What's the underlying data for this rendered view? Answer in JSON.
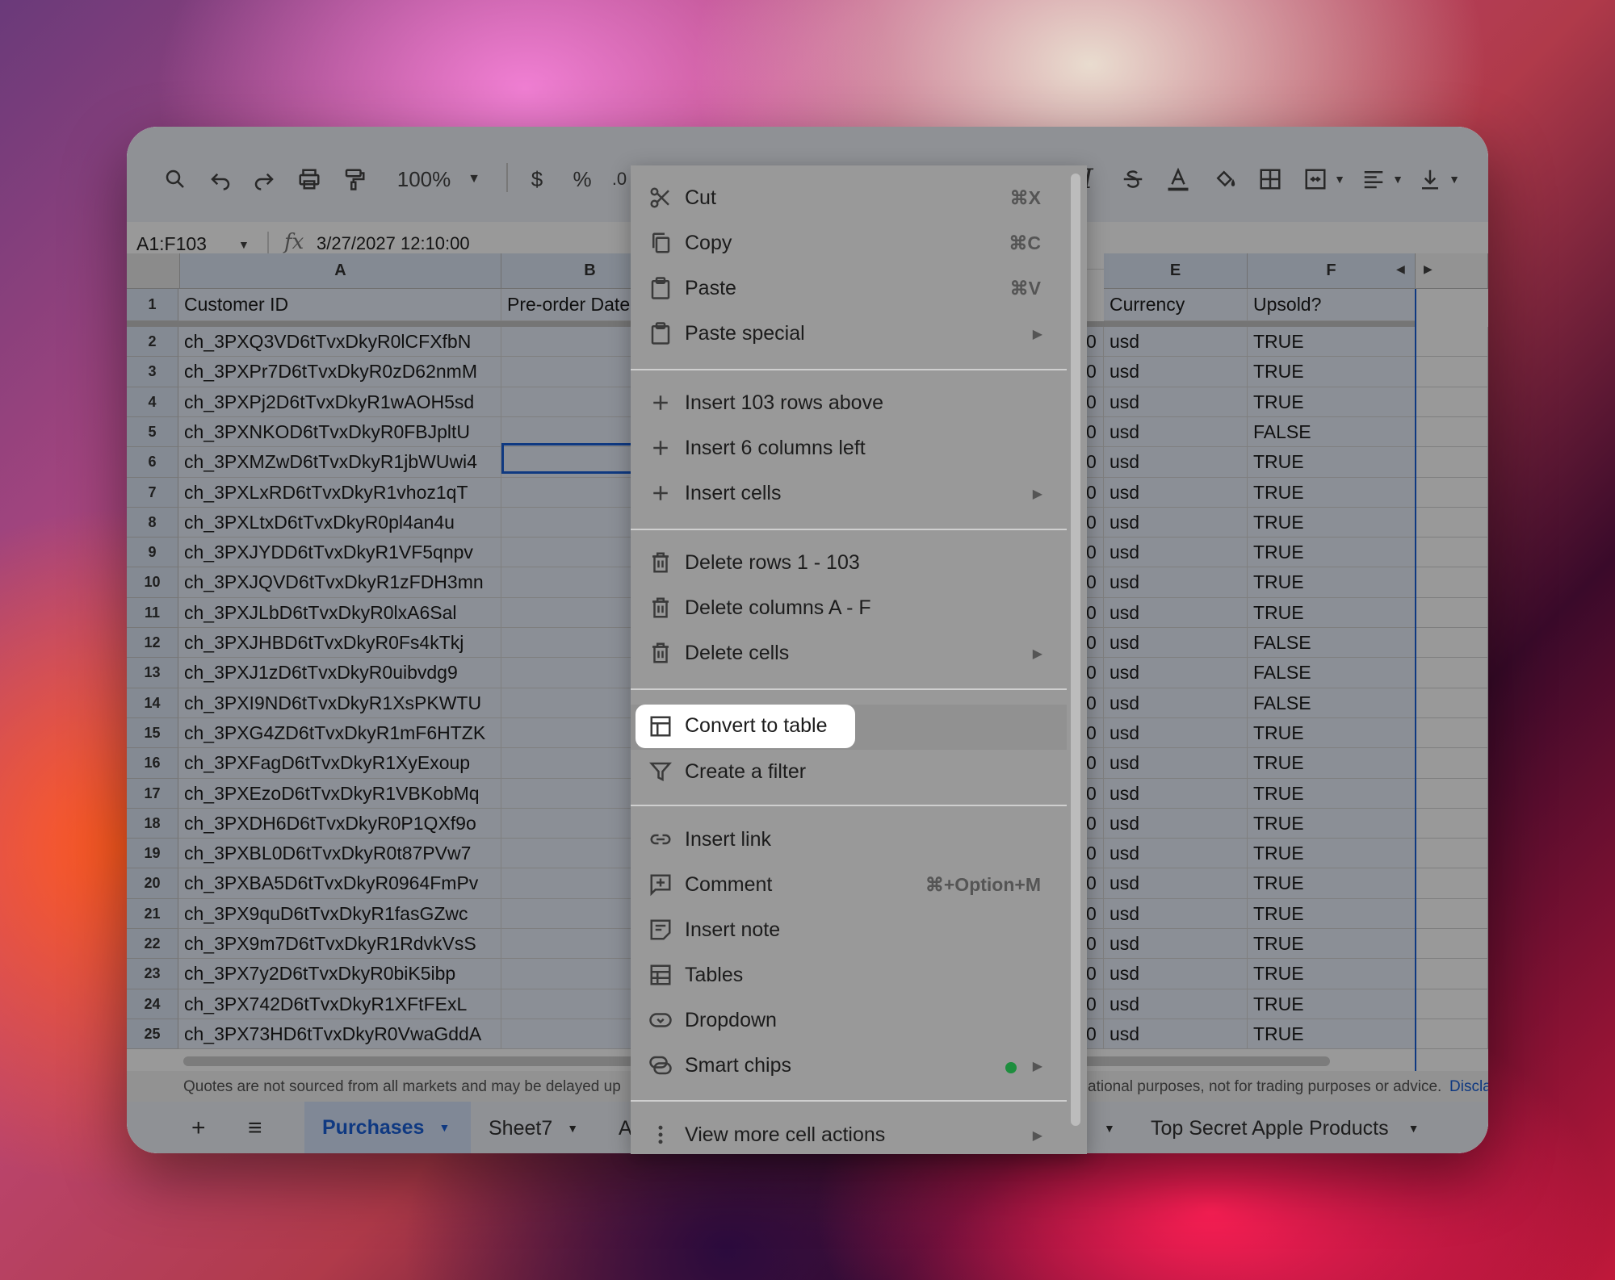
{
  "toolbar": {
    "zoom": "100%",
    "currency_symbol": "$",
    "percent_symbol": "%",
    "decimal_label": ".0"
  },
  "formula_bar": {
    "name_box": "A1:F103",
    "fx_label": "fx",
    "value": "3/27/2027 12:10:00"
  },
  "columns": [
    "A",
    "B",
    "E",
    "F"
  ],
  "header_row": {
    "row_number": "1",
    "customer_id": "Customer ID",
    "preorder": "Pre-order Date",
    "currency": "Currency",
    "upsold": "Upsold?"
  },
  "rows": [
    {
      "n": "2",
      "id": "ch_3PXQ3VD6tTvxDkyR0lCFXfbN",
      "d": "0",
      "cur": "usd",
      "up": "TRUE"
    },
    {
      "n": "3",
      "id": "ch_3PXPr7D6tTvxDkyR0zD62nmM",
      "d": "0",
      "cur": "usd",
      "up": "TRUE"
    },
    {
      "n": "4",
      "id": "ch_3PXPj2D6tTvxDkyR1wAOH5sd",
      "d": "0",
      "cur": "usd",
      "up": "TRUE"
    },
    {
      "n": "5",
      "id": "ch_3PXNKOD6tTvxDkyR0FBJpltU",
      "d": "0",
      "cur": "usd",
      "up": "FALSE"
    },
    {
      "n": "6",
      "id": "ch_3PXMZwD6tTvxDkyR1jbWUwi4",
      "d": "0",
      "cur": "usd",
      "up": "TRUE"
    },
    {
      "n": "7",
      "id": "ch_3PXLxRD6tTvxDkyR1vhoz1qT",
      "d": "0",
      "cur": "usd",
      "up": "TRUE"
    },
    {
      "n": "8",
      "id": "ch_3PXLtxD6tTvxDkyR0pl4an4u",
      "d": "0",
      "cur": "usd",
      "up": "TRUE"
    },
    {
      "n": "9",
      "id": "ch_3PXJYDD6tTvxDkyR1VF5qnpv",
      "d": "0",
      "cur": "usd",
      "up": "TRUE"
    },
    {
      "n": "10",
      "id": "ch_3PXJQVD6tTvxDkyR1zFDH3mn",
      "d": "0",
      "cur": "usd",
      "up": "TRUE"
    },
    {
      "n": "11",
      "id": "ch_3PXJLbD6tTvxDkyR0lxA6Sal",
      "d": "0",
      "cur": "usd",
      "up": "TRUE"
    },
    {
      "n": "12",
      "id": "ch_3PXJHBD6tTvxDkyR0Fs4kTkj",
      "d": "0",
      "cur": "usd",
      "up": "FALSE"
    },
    {
      "n": "13",
      "id": "ch_3PXJ1zD6tTvxDkyR0uibvdg9",
      "d": "0",
      "cur": "usd",
      "up": "FALSE"
    },
    {
      "n": "14",
      "id": "ch_3PXI9ND6tTvxDkyR1XsPKWTU",
      "d": "0",
      "cur": "usd",
      "up": "FALSE"
    },
    {
      "n": "15",
      "id": "ch_3PXG4ZD6tTvxDkyR1mF6HTZK",
      "d": "0",
      "cur": "usd",
      "up": "TRUE"
    },
    {
      "n": "16",
      "id": "ch_3PXFagD6tTvxDkyR1XyExoup",
      "d": "0",
      "cur": "usd",
      "up": "TRUE"
    },
    {
      "n": "17",
      "id": "ch_3PXEzoD6tTvxDkyR1VBKobMq",
      "d": "0",
      "cur": "usd",
      "up": "TRUE"
    },
    {
      "n": "18",
      "id": "ch_3PXDH6D6tTvxDkyR0P1QXf9o",
      "d": "0",
      "cur": "usd",
      "up": "TRUE"
    },
    {
      "n": "19",
      "id": "ch_3PXBL0D6tTvxDkyR0t87PVw7",
      "d": "0",
      "cur": "usd",
      "up": "TRUE"
    },
    {
      "n": "20",
      "id": "ch_3PXBA5D6tTvxDkyR0964FmPv",
      "d": "0",
      "cur": "usd",
      "up": "TRUE"
    },
    {
      "n": "21",
      "id": "ch_3PX9quD6tTvxDkyR1fasGZwc",
      "d": "0",
      "cur": "usd",
      "up": "TRUE"
    },
    {
      "n": "22",
      "id": "ch_3PX9m7D6tTvxDkyR1RdvkVsS",
      "d": "0",
      "cur": "usd",
      "up": "TRUE"
    },
    {
      "n": "23",
      "id": "ch_3PX7y2D6tTvxDkyR0biK5ibp",
      "d": "0",
      "cur": "usd",
      "up": "TRUE"
    },
    {
      "n": "24",
      "id": "ch_3PX742D6tTvxDkyR1XFtFExL",
      "d": "0",
      "cur": "usd",
      "up": "TRUE"
    },
    {
      "n": "25",
      "id": "ch_3PX73HD6tTvxDkyR0VwaGddA",
      "d": "0",
      "cur": "usd",
      "up": "TRUE"
    }
  ],
  "notice": {
    "left": "Quotes are not sourced from all markets and may be delayed up",
    "right": "ational purposes, not for trading purposes or advice.",
    "link": "Discla"
  },
  "tabs": {
    "add": "+",
    "menu": "≡",
    "active": "Purchases",
    "sheet7": "Sheet7",
    "partial": "A",
    "last": "Top Secret Apple Products"
  },
  "context_menu": {
    "cut": {
      "label": "Cut",
      "shortcut": "⌘X"
    },
    "copy": {
      "label": "Copy",
      "shortcut": "⌘C"
    },
    "paste": {
      "label": "Paste",
      "shortcut": "⌘V"
    },
    "paste_special": {
      "label": "Paste special"
    },
    "insert_rows": {
      "label": "Insert 103 rows above"
    },
    "insert_cols": {
      "label": "Insert 6 columns left"
    },
    "insert_cells": {
      "label": "Insert cells"
    },
    "delete_rows": {
      "label": "Delete rows 1 - 103"
    },
    "delete_cols": {
      "label": "Delete columns A - F"
    },
    "delete_cells": {
      "label": "Delete cells"
    },
    "convert_table": {
      "label": "Convert to table"
    },
    "create_filter": {
      "label": "Create a filter"
    },
    "insert_link": {
      "label": "Insert link"
    },
    "comment": {
      "label": "Comment",
      "shortcut": "⌘+Option+M"
    },
    "insert_note": {
      "label": "Insert note"
    },
    "tables": {
      "label": "Tables"
    },
    "dropdown": {
      "label": "Dropdown"
    },
    "smart_chips": {
      "label": "Smart chips"
    },
    "view_more": {
      "label": "View more cell actions"
    },
    "arrow": "▶"
  },
  "colors": {
    "accent": "#1a5fd8",
    "active_tab": "#1a5fd8",
    "smart_chip_dot": "#1e8e3e"
  }
}
